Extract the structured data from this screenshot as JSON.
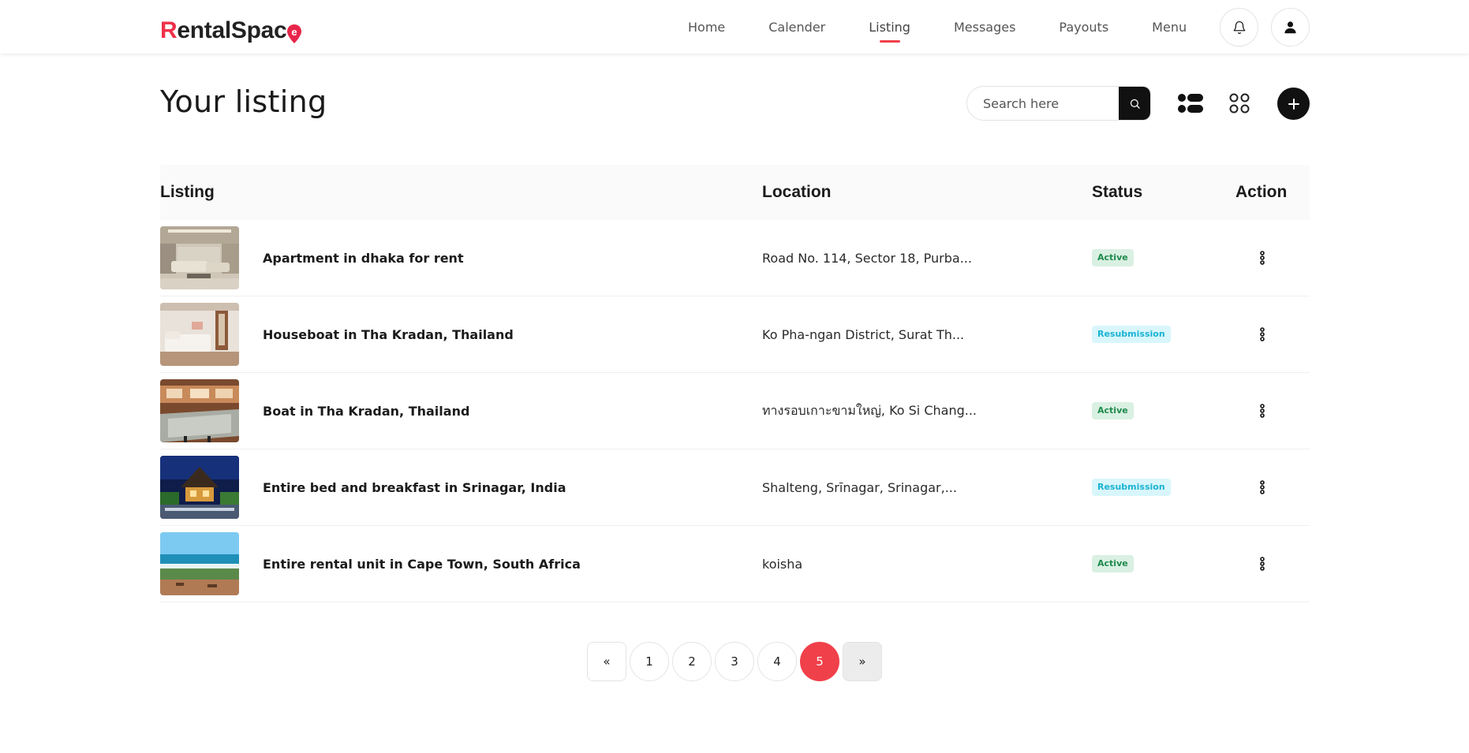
{
  "brand": {
    "first_letter": "R",
    "rest": "entalSpac",
    "last_letter": "e",
    "accent": "#f0304a"
  },
  "nav": {
    "items": [
      {
        "label": "Home"
      },
      {
        "label": "Calender"
      },
      {
        "label": "Listing",
        "active": true
      },
      {
        "label": "Messages"
      },
      {
        "label": "Payouts"
      },
      {
        "label": "Menu"
      }
    ],
    "notifications_icon": "bell-icon",
    "profile_icon": "user-icon"
  },
  "page": {
    "title": "Your listing",
    "search_placeholder": "Search here",
    "search_icon": "search-icon",
    "view_list_icon": "list-view-icon",
    "view_grid_icon": "grid-view-icon",
    "add_icon": "plus-icon"
  },
  "table": {
    "headers": {
      "listing": "Listing",
      "location": "Location",
      "status": "Status",
      "action": "Action"
    },
    "rows": [
      {
        "title": "Apartment in dhaka for rent",
        "location": "Road No. 114, Sector 18, Purba...",
        "status": "Active",
        "status_type": "active",
        "thumb": "living-room-photo"
      },
      {
        "title": "Houseboat in Tha Kradan, Thailand",
        "location": "Ko Pha-ngan District, Surat Th...",
        "status": "Resubmission",
        "status_type": "resub",
        "thumb": "bedroom-photo"
      },
      {
        "title": "Boat in Tha Kradan, Thailand",
        "location": "ทางรอบเกาะขามใหญ่, Ko Si Chang...",
        "status": "Active",
        "status_type": "active",
        "thumb": "kitchen-photo"
      },
      {
        "title": "Entire bed and breakfast in Srinagar, India",
        "location": "Shalteng, Srīnagar, Srinagar,...",
        "status": "Resubmission",
        "status_type": "resub",
        "thumb": "night-house-photo"
      },
      {
        "title": "Entire rental unit in Cape Town, South Africa",
        "location": "koisha",
        "status": "Active",
        "status_type": "active",
        "thumb": "beach-photo"
      }
    ]
  },
  "pagination": {
    "prev": "«",
    "pages": [
      "1",
      "2",
      "3",
      "4",
      "5"
    ],
    "current": "5",
    "next": "»"
  },
  "colors": {
    "active_bg": "#d9f0e2",
    "active_text": "#1f8a4c",
    "resub_bg": "#d8f6fb",
    "resub_text": "#1ab3d3",
    "current_page": "#f0404a"
  }
}
